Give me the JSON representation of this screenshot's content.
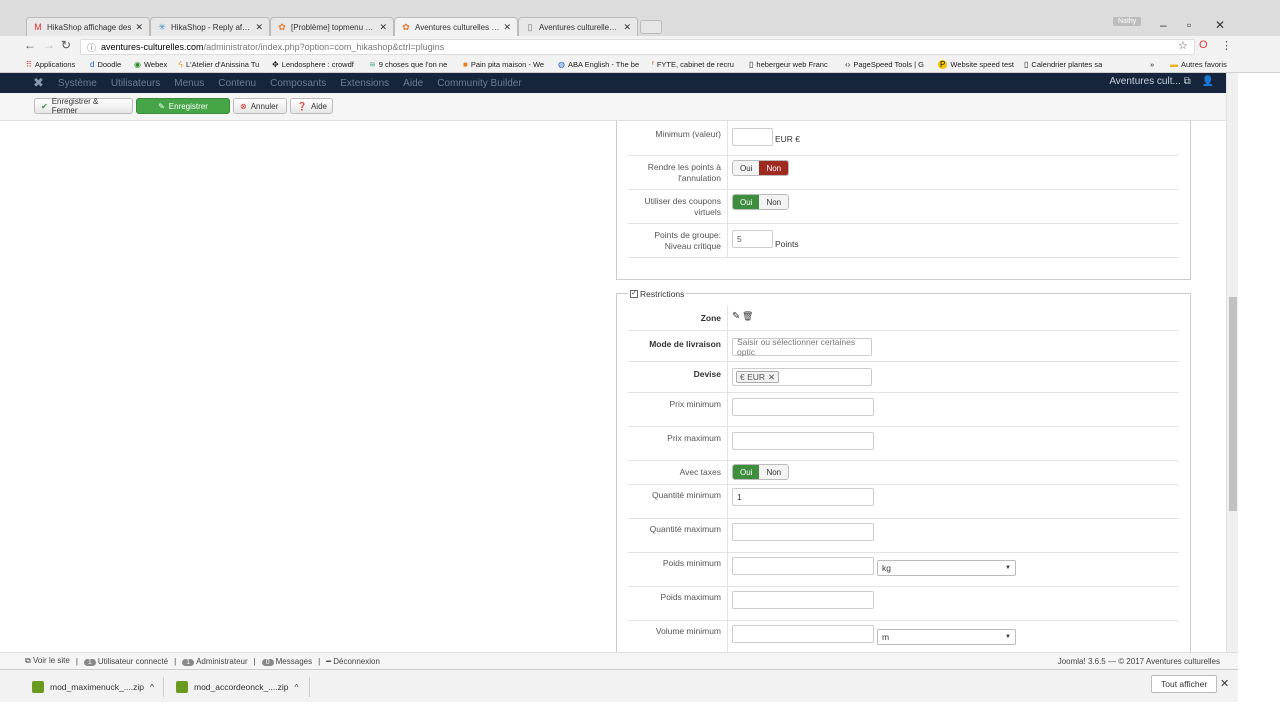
{
  "browser": {
    "tabs": [
      {
        "label": "HikaShop affichage des",
        "icon": "gmail-icon"
      },
      {
        "label": "HikaShop - Reply afficha",
        "icon": "hikashop-icon"
      },
      {
        "label": "[Problème] topmenu ave",
        "icon": "joomla-icon"
      },
      {
        "label": "Aventures culturelles - A",
        "icon": "joomla-icon"
      },
      {
        "label": "Aventures culturelles - B",
        "icon": "page-icon"
      }
    ],
    "user_badge": "Nathy",
    "url_host": "aventures-culturelles.com",
    "url_path": "/administrator/index.php?option=com_hikashop&ctrl=plugins",
    "bookmarks": [
      {
        "label": "Applications",
        "icon": "apps-icon"
      },
      {
        "label": "Doodle",
        "icon": "doodle-icon"
      },
      {
        "label": "Webex",
        "icon": "webex-icon"
      },
      {
        "label": "L'Atelier d'Anissina Tu",
        "icon": "atelier-icon"
      },
      {
        "label": "Lendosphere : crowdf",
        "icon": "lendosphere-icon"
      },
      {
        "label": "9 choses que l'on ne",
        "icon": "site-icon"
      },
      {
        "label": "Pain pita maison - We",
        "icon": "site-icon"
      },
      {
        "label": "ABA English - The be",
        "icon": "aba-icon"
      },
      {
        "label": "FYTE, cabinet de recru",
        "icon": "fyte-icon"
      },
      {
        "label": "hebergeur web Franc",
        "icon": "page-icon"
      },
      {
        "label": "PageSpeed Tools | G",
        "icon": "pagespeed-icon"
      },
      {
        "label": "Website speed test",
        "icon": "pingdom-icon"
      },
      {
        "label": "Calendrier plantes sa",
        "icon": "page-icon"
      }
    ],
    "more_bookmarks": "»",
    "other_bookmarks": "Autres favoris"
  },
  "joomla": {
    "nav": [
      "Système",
      "Utilisateurs",
      "Menus",
      "Contenu",
      "Composants",
      "Extensions",
      "Aide",
      "Community Builder"
    ],
    "site_name": "Aventures cult...",
    "toolbar": {
      "save_close": "Enregistrer & Fermer",
      "save": "Enregistrer",
      "cancel": "Annuler",
      "help": "Aide"
    }
  },
  "form": {
    "minimum_label": "Minimum (valeur)",
    "minimum_value": "",
    "minimum_unit": "EUR €",
    "refund_label": "Rendre les points à l'annulation",
    "refund_oui": "Oui",
    "refund_non": "Non",
    "virtual_label": "Utiliser des coupons virtuels",
    "virtual_oui": "Oui",
    "virtual_non": "Non",
    "group_points_label": "Points de groupe: Niveau critique",
    "group_points_value": "5",
    "group_points_unit": "Points",
    "restrictions_legend": "Restrictions",
    "zone_label": "Zone",
    "shipping_label": "Mode de livraison",
    "shipping_placeholder": "Saisir ou sélectionner certaines optic",
    "currency_label": "Devise",
    "currency_tag": "€ EUR",
    "price_min_label": "Prix minimum",
    "price_max_label": "Prix maximum",
    "with_taxes_label": "Avec taxes",
    "with_taxes_oui": "Oui",
    "with_taxes_non": "Non",
    "qty_min_label": "Quantité minimum",
    "qty_min_value": "1",
    "qty_max_label": "Quantité maximum",
    "weight_min_label": "Poids minimum",
    "weight_unit": "kg",
    "weight_max_label": "Poids maximum",
    "volume_min_label": "Volume minimum",
    "volume_unit": "m"
  },
  "statusbar": {
    "view_site": "Voir le site",
    "connected_count": "1",
    "connected_label": "Utilisateur connecté",
    "admin_count": "1",
    "admin_label": "Administrateur",
    "messages_count": "0",
    "messages_label": "Messages",
    "logout": "Déconnexion",
    "version": "Joomla! 3.6.5 — © 2017 Aventures culturelles"
  },
  "downloads": {
    "items": [
      "mod_maximenuck_....zip",
      "mod_accordeonck_....zip"
    ],
    "show_all": "Tout afficher"
  },
  "colors": {
    "joomla_nav": "#16243c",
    "green": "#46a546",
    "red": "#9e2a22"
  }
}
